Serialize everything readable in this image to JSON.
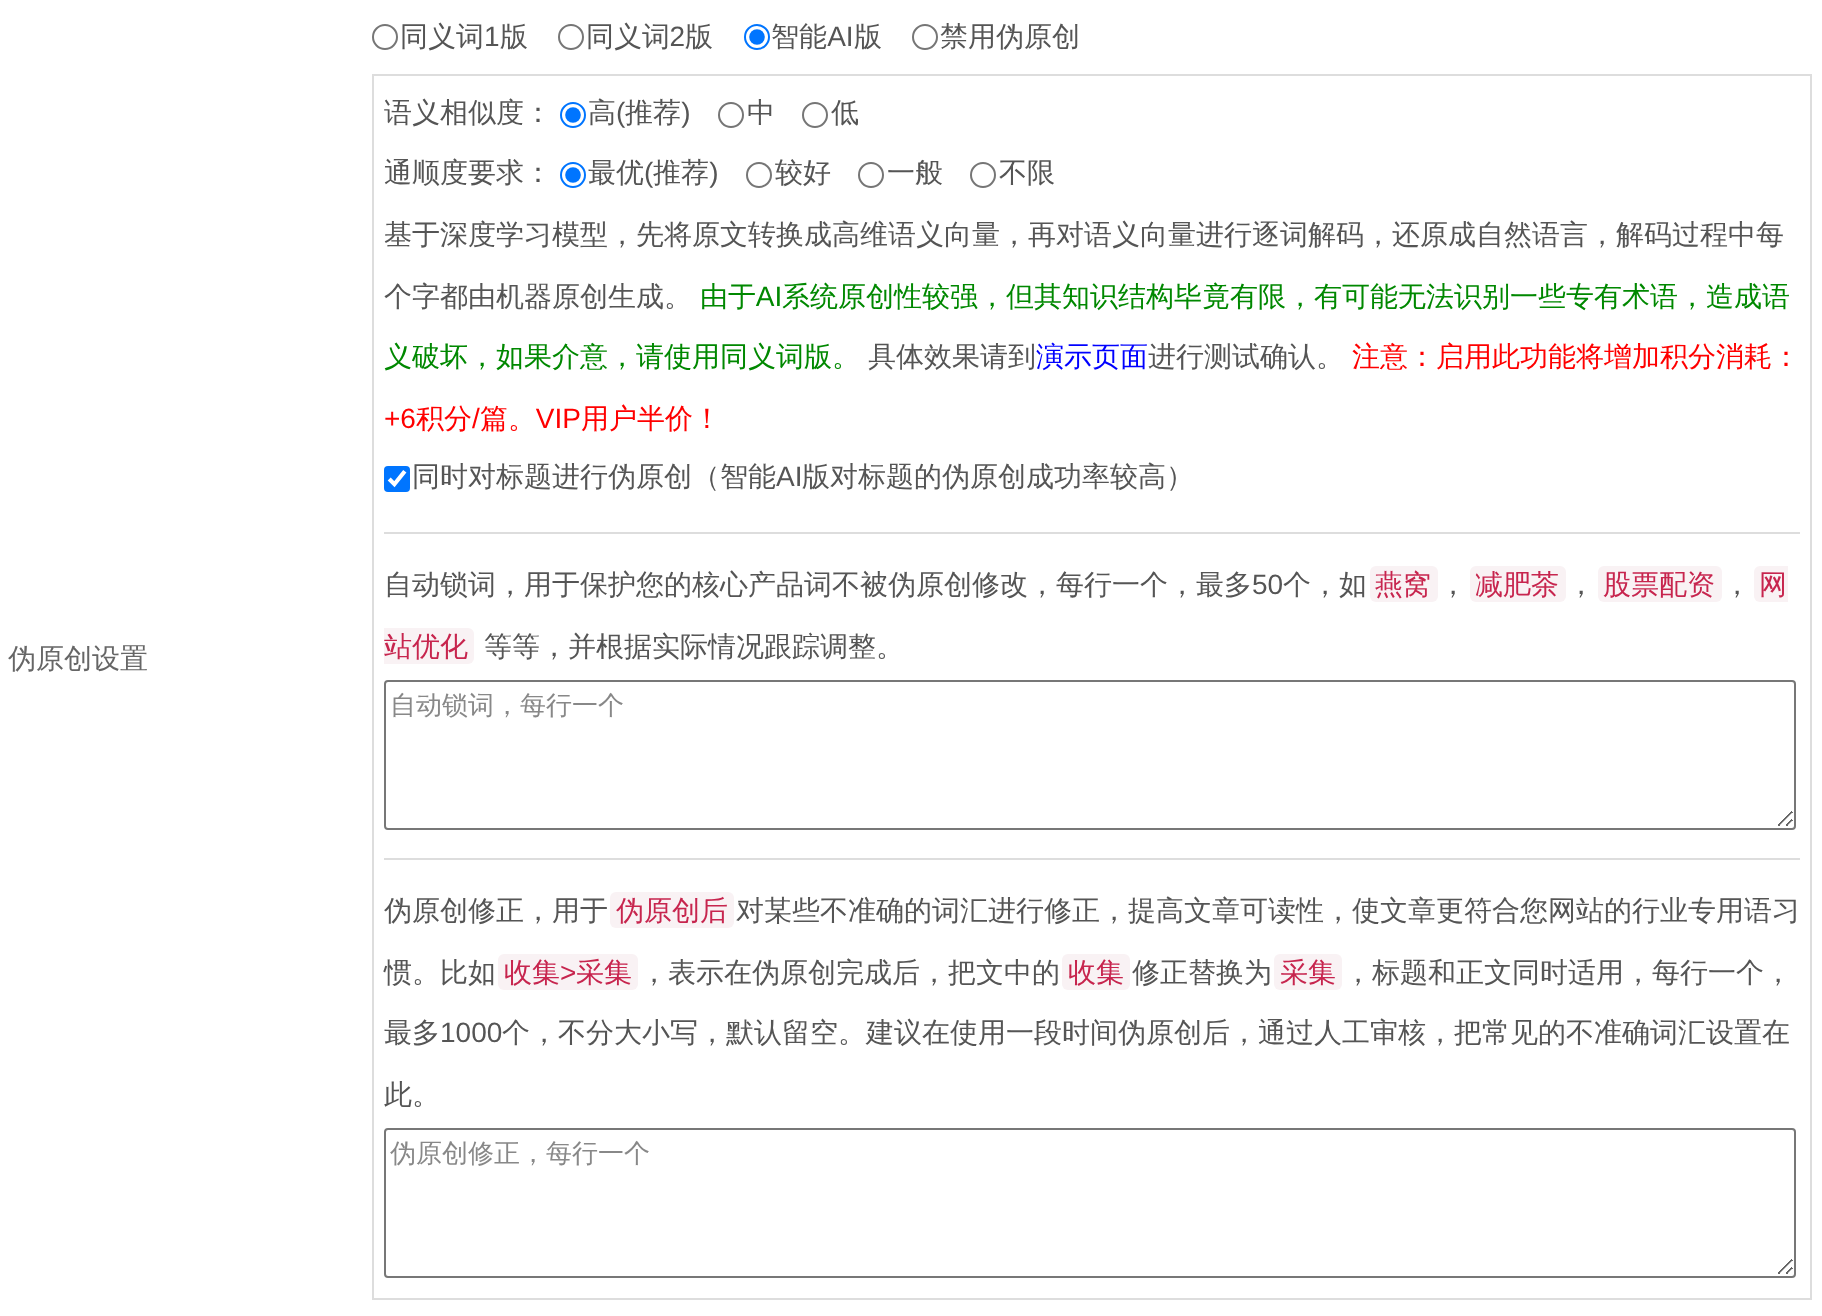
{
  "sidebar_label": "伪原创设置",
  "modes": [
    {
      "label": "同义词1版",
      "selected": false
    },
    {
      "label": "同义词2版",
      "selected": false
    },
    {
      "label": "智能AI版",
      "selected": true
    },
    {
      "label": "禁用伪原创",
      "selected": false
    }
  ],
  "similarity": {
    "label": "语义相似度：",
    "options": [
      {
        "label": "高(推荐)",
        "selected": true
      },
      {
        "label": "中",
        "selected": false
      },
      {
        "label": "低",
        "selected": false
      }
    ]
  },
  "fluency": {
    "label": "通顺度要求：",
    "options": [
      {
        "label": "最优(推荐)",
        "selected": true
      },
      {
        "label": "较好",
        "selected": false
      },
      {
        "label": "一般",
        "selected": false
      },
      {
        "label": "不限",
        "selected": false
      }
    ]
  },
  "description": [
    {
      "kind": "plain",
      "text": "基于深度学习模型，先将原文转换成高维语义向量，再对语义向量进行逐词解码，还原成自然语言，解码过程中每个字都由机器原创生成。 "
    },
    {
      "kind": "green",
      "text": "由于AI系统原创性较强，但其知识结构毕竟有限，有可能无法识别一些专有术语，造成语义破坏，如果介意，请使用同义词版。"
    },
    {
      "kind": "plain",
      "text": " 具体效果请到"
    },
    {
      "kind": "link",
      "text": "演示页面"
    },
    {
      "kind": "plain",
      "text": "进行测试确认。 "
    },
    {
      "kind": "red",
      "text": "注意：启用此功能将增加积分消耗：+6积分/篇。VIP用户半价！"
    }
  ],
  "title_option": {
    "label": "同时对标题进行伪原创（智能AI版对标题的伪原创成功率较高）",
    "checked": true
  },
  "lock_words": {
    "description": [
      {
        "kind": "plain",
        "text": "自动锁词，用于保护您的核心产品词不被伪原创修改，每行一个，最多50个，如"
      },
      {
        "kind": "tag",
        "text": "燕窝"
      },
      {
        "kind": "plain",
        "text": "，"
      },
      {
        "kind": "tag",
        "text": "减肥茶"
      },
      {
        "kind": "plain",
        "text": "，"
      },
      {
        "kind": "tag",
        "text": "股票配资"
      },
      {
        "kind": "plain",
        "text": "，"
      },
      {
        "kind": "tag",
        "text": "网站优化"
      },
      {
        "kind": "plain",
        "text": " 等等，并根据实际情况跟踪调整。"
      }
    ],
    "placeholder": "自动锁词，每行一个"
  },
  "corrections": {
    "description": [
      {
        "kind": "plain",
        "text": "伪原创修正，用于"
      },
      {
        "kind": "tag",
        "text": "伪原创后"
      },
      {
        "kind": "plain",
        "text": "对某些不准确的词汇进行修正，提高文章可读性，使文章更符合您网站的行业专用语习惯。比如"
      },
      {
        "kind": "tag",
        "text": "收集>采集"
      },
      {
        "kind": "plain",
        "text": "，表示在伪原创完成后，把文中的"
      },
      {
        "kind": "tag",
        "text": "收集"
      },
      {
        "kind": "plain",
        "text": "修正替换为"
      },
      {
        "kind": "tag",
        "text": "采集"
      },
      {
        "kind": "plain",
        "text": "，标题和正文同时适用，每行一个，最多1000个，不分大小写，默认留空。建议在使用一段时间伪原创后，通过人工审核，把常见的不准确词汇设置在此。"
      }
    ],
    "placeholder": "伪原创修正，每行一个"
  }
}
